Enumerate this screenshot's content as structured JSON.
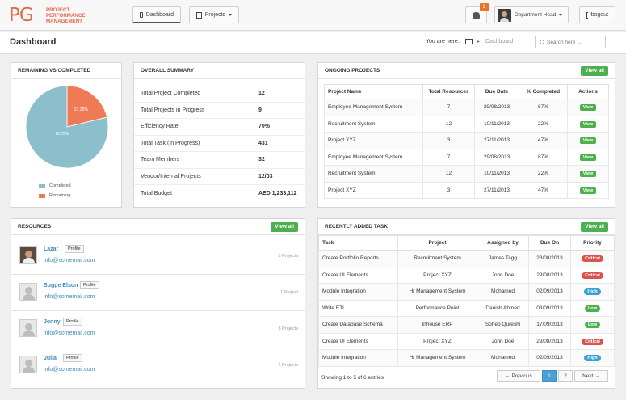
{
  "header": {
    "logo_mark": "PG",
    "logo_text": "Project Performance Management",
    "nav_dashboard": "Dashboard",
    "nav_projects": "Projects",
    "notification_count": "3",
    "user_name": "Department Head",
    "logout_label": "Logout"
  },
  "subheader": {
    "title": "Dashboard",
    "breadcrumb_label": "You are here:",
    "breadcrumb_current": "Dashboard",
    "search_placeholder": "Search here ..."
  },
  "remaining_vs_completed": {
    "title": "Remaining vs Completed",
    "legend": [
      "Completed",
      "Remaining"
    ],
    "colors": {
      "completed": "#8bbfcc",
      "remaining": "#ee7b55"
    }
  },
  "chart_data": {
    "type": "pie",
    "title": "Remaining vs Completed",
    "categories": [
      "Completed",
      "Remaining"
    ],
    "values": [
      78.75,
      21.25
    ],
    "labels": [
      "78.75%",
      "21.25%"
    ]
  },
  "overall_summary": {
    "title": "Overall Summary",
    "rows": [
      {
        "label": "Total Project Completed",
        "value": "12"
      },
      {
        "label": "Total Projects in Progress",
        "value": "9"
      },
      {
        "label": "Efficiency Rate",
        "value": "70%"
      },
      {
        "label": "Total Task (In Progress)",
        "value": "431"
      },
      {
        "label": "Team Members",
        "value": "32"
      },
      {
        "label": "Vendor/Internal Projects",
        "value": "12/03"
      },
      {
        "label": "Total Budget",
        "value": "AED 1,233,112"
      }
    ]
  },
  "ongoing_projects": {
    "title": "Ongoing Projects",
    "view_all": "View all",
    "columns": [
      "Project Name",
      "Total Resources",
      "Due Date",
      "% Completed",
      "Actions"
    ],
    "action_label": "View",
    "rows": [
      {
        "name": "Employee Management System",
        "resources": "7",
        "due": "29/08/2013",
        "pct": "87%"
      },
      {
        "name": "Recruitment System",
        "resources": "12",
        "due": "10/11/2013",
        "pct": "22%"
      },
      {
        "name": "Project XYZ",
        "resources": "3",
        "due": "27/11/2013",
        "pct": "47%"
      },
      {
        "name": "Employee Management System",
        "resources": "7",
        "due": "29/08/2013",
        "pct": "87%"
      },
      {
        "name": "Recruitment System",
        "resources": "12",
        "due": "10/11/2013",
        "pct": "22%"
      },
      {
        "name": "Project XYZ",
        "resources": "3",
        "due": "27/11/2013",
        "pct": "47%"
      }
    ]
  },
  "resources": {
    "title": "Resources",
    "view_all": "View all",
    "profile_label": "Profile",
    "items": [
      {
        "name": "Lazar",
        "email": "info@somemail.com",
        "projects": "5 Projects"
      },
      {
        "name": "Sugge Elson",
        "email": "info@somemail.com",
        "projects": "1 Project"
      },
      {
        "name": "Jonny",
        "email": "info@somemail.com",
        "projects": "3 Projects"
      },
      {
        "name": "Julia",
        "email": "info@somemail.com",
        "projects": "2 Projects"
      }
    ]
  },
  "recent_tasks": {
    "title": "Recently Added Task",
    "view_all": "View all",
    "columns": [
      "Task",
      "Project",
      "Assigned by",
      "Due On",
      "Priority"
    ],
    "rows": [
      {
        "task": "Create Portfolio Reports",
        "project": "Recruitment System",
        "assigned": "James Tagg",
        "due": "23/08/2013",
        "priority": "Critical",
        "color": "#d9534f"
      },
      {
        "task": "Create UI Elements",
        "project": "Project XYZ",
        "assigned": "John Doe",
        "due": "29/08/2013",
        "priority": "Critical",
        "color": "#d9534f"
      },
      {
        "task": "Module Integration",
        "project": "Hr Management System",
        "assigned": "Mohamed",
        "due": "02/09/2013",
        "priority": "High",
        "color": "#3aa2d3"
      },
      {
        "task": "Write ETL",
        "project": "Performance Point",
        "assigned": "Danish Ahmed",
        "due": "03/09/2013",
        "priority": "Low",
        "color": "#4caf50"
      },
      {
        "task": "Create Database Schema",
        "project": "Inhouse ERP",
        "assigned": "Soheb Qureshi",
        "due": "17/09/2013",
        "priority": "Low",
        "color": "#4caf50"
      },
      {
        "task": "Create UI Elements",
        "project": "Project XYZ",
        "assigned": "John Doe",
        "due": "29/08/2013",
        "priority": "Critical",
        "color": "#d9534f"
      },
      {
        "task": "Module Integration",
        "project": "Hr Management System",
        "assigned": "Mohamed",
        "due": "02/09/2013",
        "priority": "High",
        "color": "#3aa2d3"
      }
    ],
    "pager_info": "Showing 1 to 5 of 6 entries",
    "pager": {
      "prev": "← Previous",
      "pages": [
        "1",
        "2"
      ],
      "next": "Next →"
    }
  }
}
